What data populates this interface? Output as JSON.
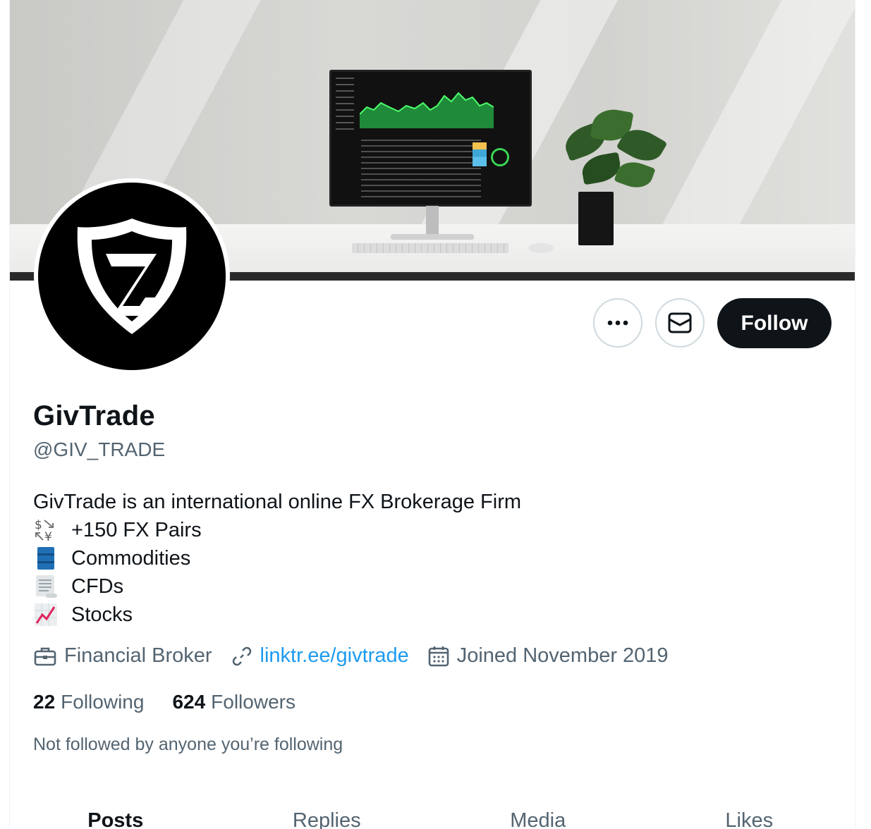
{
  "profile": {
    "name": "GivTrade",
    "handle": "@GIV_TRADE",
    "bio_intro": "GivTrade is an international online FX Brokerage Firm",
    "bio_items": [
      {
        "icon": "currency-exchange-icon",
        "text": "+150 FX Pairs"
      },
      {
        "icon": "oil-drum-icon",
        "text": "Commodities"
      },
      {
        "icon": "document-scroll-icon",
        "text": "CFDs"
      },
      {
        "icon": "chart-increasing-icon",
        "text": "Stocks"
      }
    ],
    "category": "Financial Broker",
    "link": "linktr.ee/givtrade",
    "joined": "Joined November 2019",
    "following_count": "22",
    "following_label": "Following",
    "followers_count": "624",
    "followers_label": "Followers",
    "followed_by": "Not followed by anyone you’re following"
  },
  "actions": {
    "more_icon": "more-dots-icon",
    "message_icon": "envelope-icon",
    "follow_label": "Follow"
  },
  "tabs": [
    "Posts",
    "Replies",
    "Media",
    "Likes"
  ],
  "colors": {
    "text": "#0f1419",
    "secondary": "#536471",
    "link": "#1d9bf0",
    "button_border": "#cfd9de"
  }
}
